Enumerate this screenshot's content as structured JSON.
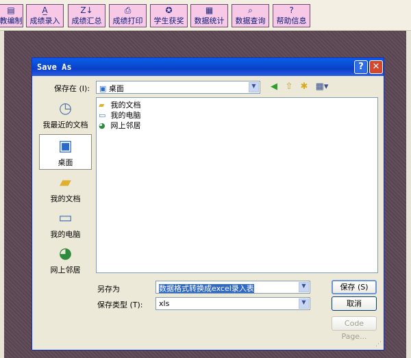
{
  "toolbar": {
    "buttons": [
      {
        "label": "教编制",
        "icon": "book-icon"
      },
      {
        "label": "成绩录入",
        "icon": "letter-a-icon"
      },
      {
        "label": "成绩汇总",
        "icon": "sort-az-icon"
      },
      {
        "label": "成绩打印",
        "icon": "printer-icon"
      },
      {
        "label": "学生获奖",
        "icon": "award-icon"
      },
      {
        "label": "数据统计",
        "icon": "chart-icon"
      },
      {
        "label": "数据查询",
        "icon": "query-icon"
      },
      {
        "label": "帮助信息",
        "icon": "help-icon"
      }
    ]
  },
  "dialog": {
    "title": "Save As",
    "help_glyph": "?",
    "close_glyph": "✕",
    "save_in_label": "保存在 (I):",
    "save_in_value": "桌面",
    "places": [
      {
        "label": "我最近的文档",
        "icon": "recent-docs-icon"
      },
      {
        "label": "桌面",
        "icon": "desktop-icon"
      },
      {
        "label": "我的文档",
        "icon": "my-documents-icon"
      },
      {
        "label": "我的电脑",
        "icon": "my-computer-icon"
      },
      {
        "label": "网上邻居",
        "icon": "network-places-icon"
      }
    ],
    "files": [
      {
        "name": "我的文档",
        "icon": "folder-icon"
      },
      {
        "name": "我的电脑",
        "icon": "computer-icon"
      },
      {
        "name": "网上邻居",
        "icon": "network-icon"
      }
    ],
    "filename_label": "另存为",
    "filename_value": "数据格式转换成excel录入表",
    "filetype_label": "保存类型 (T):",
    "filetype_value": "xls",
    "save_button": "保存 (S)",
    "cancel_button": "取消",
    "code_page_button": "Code Page..."
  }
}
